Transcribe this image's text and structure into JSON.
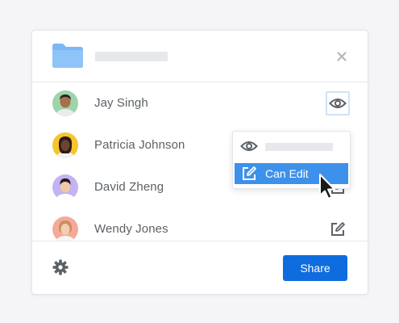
{
  "dialog": {
    "close_icon": "close-icon",
    "folder_icon": "folder-icon",
    "members": [
      {
        "name": "Jay Singh",
        "permission_icon": "eye-icon",
        "selected": true
      },
      {
        "name": "Patricia Johnson",
        "permission_icon": "none"
      },
      {
        "name": "David Zheng",
        "permission_icon": "edit-icon"
      },
      {
        "name": "Wendy Jones",
        "permission_icon": "edit-icon"
      }
    ],
    "dropdown": {
      "options": [
        {
          "icon": "eye-icon",
          "label": ""
        },
        {
          "icon": "edit-icon",
          "label": "Can Edit",
          "highlighted": true
        }
      ]
    },
    "footer": {
      "settings_icon": "gear-icon",
      "share_label": "Share"
    }
  },
  "colors": {
    "accent": "#0f6cde",
    "highlight": "#3d91ea",
    "folder": "#7ab8f5",
    "text": "#5c6166",
    "placeholder": "#e6e8eb"
  }
}
